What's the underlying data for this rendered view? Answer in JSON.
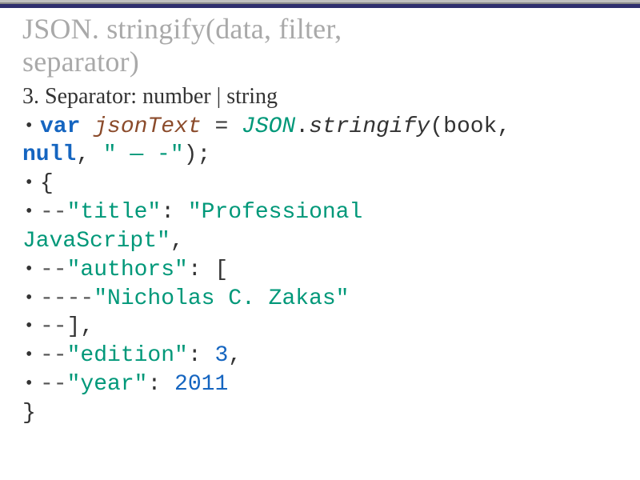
{
  "title_line1": "JSON. stringify(data, filter,",
  "title_line2": "separator)",
  "subhead": "3. Separator: number | string",
  "code": {
    "l1_var": "var",
    "l1_name": " jsonText",
    "l1_eq": " = ",
    "l1_json": "JSON",
    "l1_dot": ".",
    "l1_method": "stringify",
    "l1_open": "(book,",
    "l1b_null": "null",
    "l1b_comma": ", ",
    "l1b_str": "\" — -\"",
    "l1b_close": ");",
    "l2_brace": "{",
    "l3_pfx": "--",
    "l3_key": "\"title\"",
    "l3_colon": ": ",
    "l3_val": "\"Professional",
    "l3b_val": "JavaScript\"",
    "l3b_comma": ",",
    "l4_pfx": "--",
    "l4_key": "\"authors\"",
    "l4_colon": ": [",
    "l5_pfx": "----",
    "l5_val": "\"Nicholas C. Zakas\"",
    "l6_pfx": "--",
    "l6_close": "],",
    "l7_pfx": "--",
    "l7_key": "\"edition\"",
    "l7_colon": ": ",
    "l7_val": "3",
    "l7_comma": ",",
    "l8_pfx": "--",
    "l8_key": "\"year\"",
    "l8_colon": ": ",
    "l8_val": "2011",
    "l9_brace": "}"
  }
}
